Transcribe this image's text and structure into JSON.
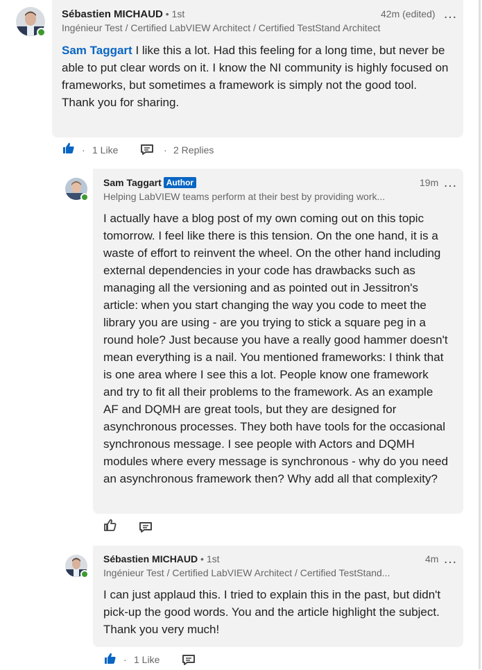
{
  "comment1": {
    "author": "Sébastien MICHAUD",
    "degree": " • 1st",
    "headline": "Ingénieur Test / Certified LabVIEW Architect / Certified TestStand Architect",
    "time": "42m (edited)",
    "mention": "Sam Taggart",
    "text_after_mention": " I like this a lot. Had this feeling for a long time, but never be able to put clear words on it. I know the NI community is highly focused on frameworks, but sometimes a framework is simply not the good tool.",
    "text_line2": "Thank you for sharing.",
    "likes": "1 Like",
    "replies": "2 Replies",
    "dot": "·"
  },
  "reply1": {
    "author": "Sam Taggart",
    "badge": "Author",
    "headline": "Helping LabVIEW teams perform at their best by providing work...",
    "time": "19m",
    "text": "I actually have a blog post of my own coming out on this topic tomorrow.  I feel like there is this tension. On the one hand, it is a waste of effort to reinvent the wheel. On the other hand including external dependencies in your code has drawbacks such as managing all the versioning and as pointed out in Jessitron's article: when you start changing the way you code to meet the library you are using - are you trying to stick a square peg in a round hole? Just because you have a really good hammer doesn't mean everything is a nail. You mentioned frameworks: I think that is one area where I see this a lot. People know one framework and try to fit all their problems to the framework. As an example AF and DQMH are great tools, but they are designed for asynchronous processes. They both have tools for the occasional synchronous message. I see people with Actors and DQMH modules where every message is synchronous - why do you need an asynchronous framework then? Why add all that complexity?"
  },
  "reply2": {
    "author": "Sébastien MICHAUD",
    "degree": " • 1st",
    "headline": "Ingénieur Test / Certified LabVIEW Architect / Certified TestStand...",
    "time": "4m",
    "text": "I can just applaud this. I tried to explain this in the past, but didn't pick-up the good words. You and the article highlight the subject. Thank you very much!",
    "likes": "1 Like",
    "dot": "·"
  },
  "more_label": "…",
  "colors": {
    "accent": "#0a66c2",
    "bubble": "#f2f2f2",
    "online": "#3d9a2f"
  },
  "icons": [
    "like-filled-icon",
    "like-outline-icon",
    "comment-icon",
    "more-icon"
  ]
}
